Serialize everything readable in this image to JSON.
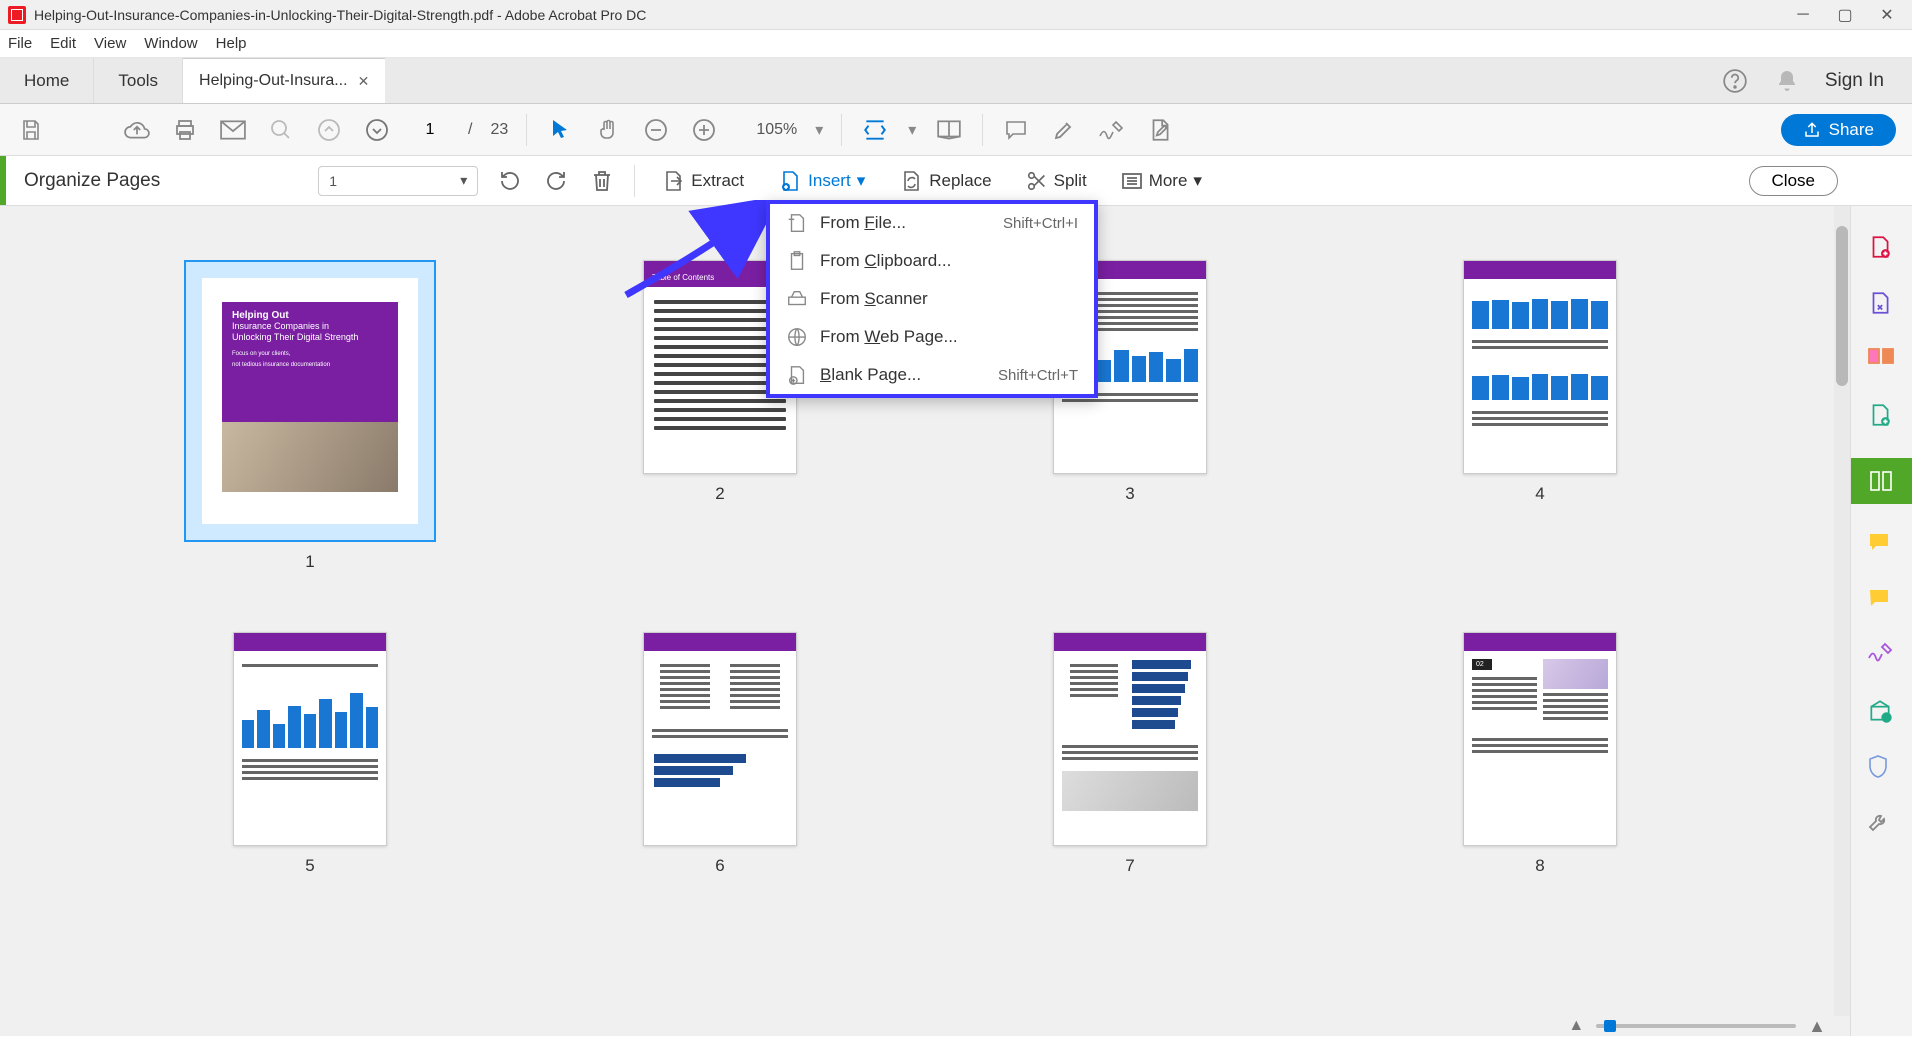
{
  "titlebar": {
    "title": "Helping-Out-Insurance-Companies-in-Unlocking-Their-Digital-Strength.pdf - Adobe Acrobat Pro DC"
  },
  "menubar": [
    "File",
    "Edit",
    "View",
    "Window",
    "Help"
  ],
  "tabs": {
    "home": "Home",
    "tools": "Tools",
    "active": "Helping-Out-Insura...",
    "signin": "Sign In"
  },
  "toolbar": {
    "page_current": "1",
    "page_sep": "/",
    "page_total": "23",
    "zoom": "105%",
    "share": "Share"
  },
  "organize": {
    "title": "Organize Pages",
    "page_select": "1",
    "extract": "Extract",
    "insert": "Insert",
    "replace": "Replace",
    "split": "Split",
    "more": "More",
    "close": "Close"
  },
  "insert_menu": {
    "from_file": {
      "pre": "From ",
      "u": "F",
      "post": "ile...",
      "shortcut": "Shift+Ctrl+I"
    },
    "from_clipboard": {
      "pre": "From ",
      "u": "C",
      "post": "lipboard..."
    },
    "from_scanner": {
      "pre": "From ",
      "u": "S",
      "post": "canner"
    },
    "from_webpage": {
      "pre": "From ",
      "u": "W",
      "post": "eb Page..."
    },
    "blank_page": {
      "pre": "",
      "u": "B",
      "post": "lank Page...",
      "shortcut": "Shift+Ctrl+T"
    }
  },
  "thumbnails": {
    "labels": [
      "1",
      "2",
      "3",
      "4",
      "5",
      "6",
      "7",
      "8"
    ],
    "page1": {
      "title": "Helping Out",
      "line2": "Insurance Companies in",
      "line3": "Unlocking Their Digital Strength",
      "sub1": "Focus on your clients,",
      "sub2": "not tedious insurance documentation"
    },
    "page2": {
      "heading": "Table of Contents"
    }
  },
  "colors": {
    "accent_blue": "#0078d7",
    "accent_green": "#51a728",
    "brand_purple": "#7a1fa2",
    "highlight_border": "#3f37ff"
  }
}
